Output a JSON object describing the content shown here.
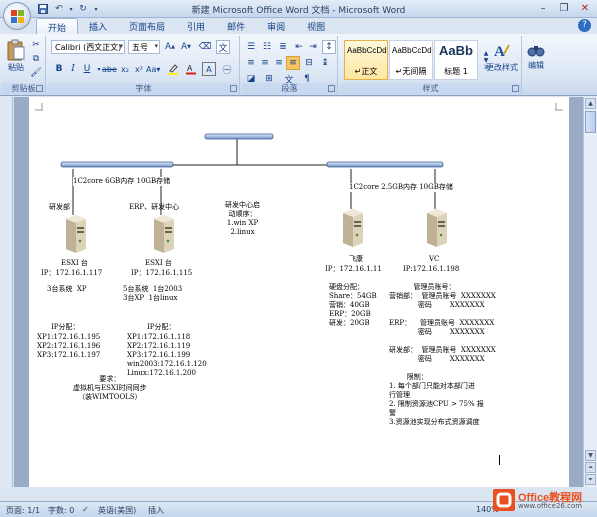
{
  "window": {
    "title": "新建 Microsoft Office Word 文档 - Microsoft Word"
  },
  "tabs": [
    "开始",
    "插入",
    "页面布局",
    "引用",
    "邮件",
    "审阅",
    "视图"
  ],
  "ribbon": {
    "clipboard": {
      "paste_label": "粘贴",
      "group_label": "剪贴板"
    },
    "font": {
      "font_name": "Calibri (西文正文)",
      "font_size": "五号",
      "group_label": "字体"
    },
    "paragraph": {
      "group_label": "段落"
    },
    "styles": {
      "items": [
        {
          "sample": "AaBbCcDd",
          "name": "↵正文"
        },
        {
          "sample": "AaBbCcDd",
          "name": "↵无间隔"
        },
        {
          "sample": "AaBb",
          "name": "标题 1"
        }
      ],
      "change_styles_label": "更改样式",
      "group_label": "样式"
    },
    "editing": {
      "label": "编辑"
    }
  },
  "document": {
    "left": {
      "link_text": "1C2core 6GB内存 10GB存储",
      "dept_a": "研发部",
      "dept_b": "ERP、研发中心",
      "server_a": {
        "name": "ESXI 台",
        "ip": "IP：172.16.1.117",
        "vms": "3台系统  XP"
      },
      "server_b": {
        "name": "ESXI 台",
        "ip": "IP：172.16.1.115",
        "vms": "5台系统  1台2003\n3台XP  1台linux"
      },
      "ip_a_title": "IP分配：",
      "ip_a": "XP1:172.16.1.195\nXP2:172.16.1.196\nXP3:172.16.1.197",
      "ip_b_title": "IP分配：",
      "ip_b": "XP1:172.16.1.118\nXP2:172.16.1.119\nXP3:172.16.1.199\nwin2003:172.16.1.120\nLinux:172.16.1.200",
      "requirement": "要求：\n虚拟机与ESXI时间同步\n（装WIMTOOLS）"
    },
    "center": {
      "note": "研发中心启\n动顺序：\n1.win XP\n2.linux"
    },
    "right": {
      "link_text": "1C2core 2.5GB内存 10GB存储",
      "server_a": {
        "name": "飞康",
        "ip": "IP：172.16.1.11"
      },
      "server_b": {
        "name": "VC",
        "ip": "IP:172.16.1.198"
      },
      "disk": "硬盘分配：\nShare：54GB\n营销：40GB\nERP：20GB\n研发：20GB",
      "admin": "           管理员账号：\n营销部：  管理员账号  XXXXXXX\n             密码        XXXXXXX\n\nERP：    管理员账号  XXXXXXX\n             密码        XXXXXXX\n\n研发部：  管理员账号  XXXXXXX\n             密码        XXXXXXX",
      "limits": "        限制：\n1. 每个部门只能对本部门进\n行管理\n2. 限制资源池CPU > 75% 报\n警\n3.资源池实现分布式资源调度"
    }
  },
  "status": {
    "page": "页面: 1/1",
    "words": "字数: 0",
    "language": "英语(美国)",
    "mode": "插入",
    "zoom": "140%"
  },
  "watermark": {
    "brand": "Office教程网",
    "url": "www.office26.com"
  },
  "colors": {
    "ribbon_blue": "#dbe6f4",
    "accent_text": "#15428b",
    "network_bar": "#c5d6ee",
    "watermark_orange": "#e9501e"
  }
}
